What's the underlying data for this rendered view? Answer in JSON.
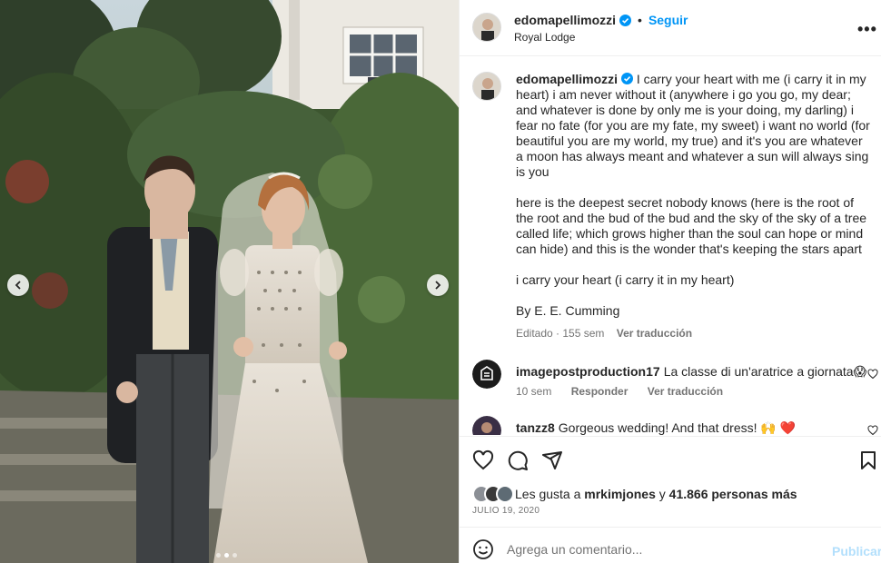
{
  "post": {
    "username": "edomapellimozzi",
    "follow_label": "Seguir",
    "separator": "•",
    "location": "Royal Lodge",
    "more_label": "•••"
  },
  "caption": {
    "username": "edomapellimozzi",
    "paragraphs": [
      "I carry your heart with me (i carry it in my heart) i am never without it (anywhere i go you go, my dear; and whatever is done by only me is your doing, my darling) i fear no fate (for you are my fate, my sweet) i want no world (for beautiful you are my world, my true) and it's you are whatever a moon has always meant and whatever a sun will always sing is you",
      "here is the deepest secret nobody knows (here is the root of the root and the bud of the bud and the sky of the sky of a tree called life; which grows higher than the soul can hope or mind can hide) and this is the wonder that's keeping the stars apart",
      "i carry your heart (i carry it in my heart)",
      "By E. E. Cumming"
    ],
    "meta": "Editado · 155 sem",
    "translate_label": "Ver traducción"
  },
  "comments": [
    {
      "username": "imagepostproduction17",
      "text": "La classe di un'aratrice a giornata😱",
      "time": "10 sem",
      "reply_label": "Responder",
      "translate_label": "Ver traducción"
    },
    {
      "username": "tanzz8",
      "text": "Gorgeous wedding! And that dress! 🙌 ❤️"
    }
  ],
  "likes": {
    "prefix": "Les gusta a",
    "user": "mrkimjones",
    "conj": "y",
    "others": "41.866 personas más"
  },
  "date": "JULIO 19, 2020",
  "add_comment": {
    "placeholder": "Agrega un comentario...",
    "publish_label": "Publicar"
  },
  "carousel": {
    "slide_count": 3,
    "active_index": 1
  },
  "colors": {
    "accent": "#0095f6",
    "verified": "#0095f6",
    "publish_disabled": "#b2dffc",
    "heart": "#ed4956",
    "muted": "#737373"
  },
  "icons": [
    "verified-icon",
    "more-icon",
    "heart-icon",
    "comment-icon",
    "share-icon",
    "save-icon",
    "emoji-icon",
    "chevron-left-icon",
    "chevron-right-icon"
  ]
}
